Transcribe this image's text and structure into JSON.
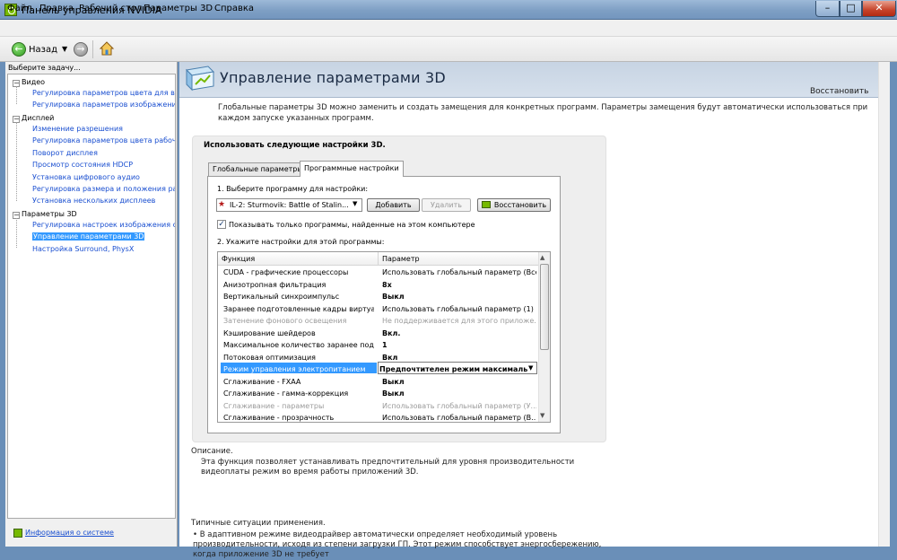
{
  "window": {
    "title": "Панель управления NVIDIA",
    "buttons": {
      "minimize": "–",
      "maximize": "□",
      "close": "✕"
    }
  },
  "menu": {
    "items": [
      "Файл",
      "Правка",
      "Рабочий стол",
      "Параметры 3D",
      "Справка"
    ]
  },
  "toolbar": {
    "back_label": "Назад",
    "back_dropdown": "▼",
    "back_icon": "←",
    "forward_icon": "→"
  },
  "sidebar": {
    "prompt": "Выберите задачу...",
    "categories": [
      {
        "label": "Видео",
        "expander": "−",
        "items": [
          {
            "label": "Регулировка параметров цвета для вид"
          },
          {
            "label": "Регулировка параметров изображения ,"
          }
        ]
      },
      {
        "label": "Дисплей",
        "expander": "−",
        "items": [
          {
            "label": "Изменение разрешения"
          },
          {
            "label": "Регулировка параметров цвета рабочег"
          },
          {
            "label": "Поворот дисплея"
          },
          {
            "label": "Просмотр состояния HDCP"
          },
          {
            "label": "Установка цифрового аудио"
          },
          {
            "label": "Регулировка размера и положения рабі"
          },
          {
            "label": "Установка нескольких дисплеев"
          }
        ]
      },
      {
        "label": "Параметры 3D",
        "expander": "−",
        "items": [
          {
            "label": "Регулировка настроек изображения с п"
          },
          {
            "label": "Управление параметрами 3D",
            "selected": true
          },
          {
            "label": "Настройка Surround, PhysX"
          }
        ]
      }
    ],
    "system_info": "Информация о системе"
  },
  "main": {
    "title": "Управление параметрами 3D",
    "restore": "Восстановить",
    "description": "Глобальные параметры 3D можно заменить и создать замещения для конкретных программ. Параметры замещения будут автоматически использоваться при каждом запуске указанных программ.",
    "settings_heading": "Использовать следующие настройки 3D.",
    "tabs": [
      {
        "label": "Глобальные параметры",
        "active": false
      },
      {
        "label": "Программные настройки",
        "active": true
      }
    ],
    "step1": "1. Выберите программу для настройки:",
    "selected_program": "IL-2: Sturmovik: Battle of Stalin...",
    "add_button": "Добавить",
    "delete_button": "Удалить",
    "restore_button": "Восстановить",
    "show_only_checkbox": {
      "label": "Показывать только программы, найденные на этом компьютере",
      "checked": true
    },
    "step2": "2. Укажите настройки для этой программы:",
    "table": {
      "headers": [
        "Функция",
        "Параметр"
      ],
      "rows": [
        {
          "feature": "CUDA - графические процессоры",
          "value": "Использовать глобальный параметр (Все)",
          "bold": false,
          "disabled": false
        },
        {
          "feature": "Анизотропная фильтрация",
          "value": "8x",
          "bold": true,
          "disabled": false
        },
        {
          "feature": "Вертикальный синхроимпульс",
          "value": "Выкл",
          "bold": true,
          "disabled": false
        },
        {
          "feature": "Заранее подготовленные кадры виртуа...",
          "value": "Использовать глобальный параметр (1)",
          "bold": false,
          "disabled": false
        },
        {
          "feature": "Затенение фонового освещения",
          "value": "Не поддерживается для этого приложе...",
          "bold": false,
          "disabled": true
        },
        {
          "feature": "Кэширование шейдеров",
          "value": "Вкл.",
          "bold": true,
          "disabled": false
        },
        {
          "feature": "Максимальное количество заранее под...",
          "value": "1",
          "bold": true,
          "disabled": false
        },
        {
          "feature": "Потоковая оптимизация",
          "value": "Вкл",
          "bold": true,
          "disabled": false
        },
        {
          "feature": "Режим управления электропитанием",
          "value": "Предпочтителен режим максималь",
          "bold": true,
          "disabled": false,
          "selected": true
        },
        {
          "feature": "Сглаживание - FXAA",
          "value": "Выкл",
          "bold": true,
          "disabled": false
        },
        {
          "feature": "Сглаживание - гамма-коррекция",
          "value": "Выкл",
          "bold": true,
          "disabled": false
        },
        {
          "feature": "Сглаживание - параметры",
          "value": "Использовать глобальный параметр (У...",
          "bold": false,
          "disabled": true
        },
        {
          "feature": "Сглаживание - прозрачность",
          "value": "Использовать глобальный параметр (В...",
          "bold": false,
          "disabled": false
        }
      ]
    },
    "description_label": "Описание.",
    "description_text": "Эта функция позволяет устанавливать предпочтительный для уровня производительности видеоплаты режим во время работы приложений 3D.",
    "usage_label": "Типичные ситуации применения.",
    "usage_text": "• В адаптивном режиме видеодрайвер автоматически определяет необходимый уровень производительности, исходя из степени загрузки ГП. Этот режим способствует энергосбережению, когда приложение 3D не требует"
  },
  "colors": {
    "nvidia_green": "#76b900",
    "selection_blue": "#3399ff",
    "link_blue": "#1a4fd0"
  }
}
